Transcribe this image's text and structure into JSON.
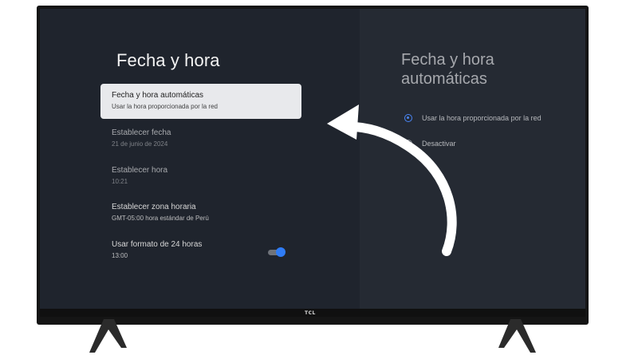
{
  "left_panel": {
    "title": "Fecha y hora",
    "items": [
      {
        "primary": "Fecha y hora automáticas",
        "secondary": "Usar la hora proporcionada por la red"
      },
      {
        "primary": "Establecer fecha",
        "secondary": "21 de junio de 2024"
      },
      {
        "primary": "Establecer hora",
        "secondary": "10:21"
      },
      {
        "primary": "Establecer zona horaria",
        "secondary": "GMT-05:00 hora estándar de Perú"
      },
      {
        "primary": "Usar formato de 24 horas",
        "secondary": "13:00"
      }
    ]
  },
  "right_panel": {
    "title": "Fecha y hora automáticas",
    "options": [
      {
        "label": "Usar la hora proporcionada por la red",
        "selected": true
      },
      {
        "label": "Desactivar",
        "selected": false
      }
    ]
  },
  "tv": {
    "brand": "TCL"
  },
  "colors": {
    "screen_background": "#1f242d",
    "accent": "#2f7cf6"
  },
  "icons": {
    "arrow": "curved-arrow-icon",
    "toggle": "toggle-on-icon",
    "radio": "radio-button-icon"
  }
}
